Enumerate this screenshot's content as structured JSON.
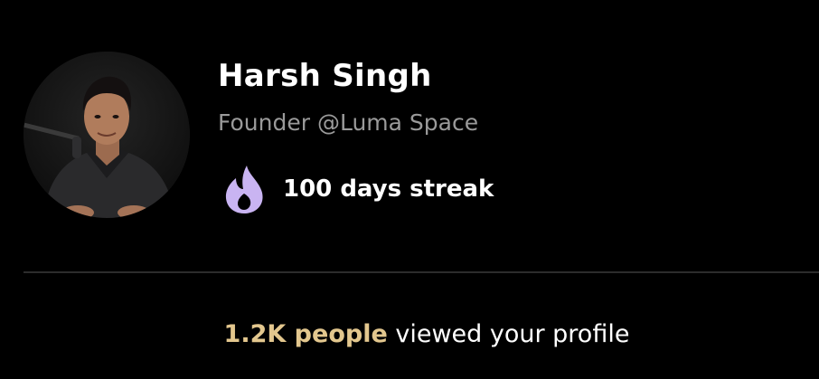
{
  "profile": {
    "name": "Harsh Singh",
    "role": "Founder @Luma Space",
    "streak_label": "100 days streak",
    "streak_icon": "flame-icon"
  },
  "views": {
    "highlight": "1.2K people",
    "suffix": " viewed your profile"
  },
  "colors": {
    "background": "#000000",
    "name": "#ffffff",
    "role": "#9a9a9a",
    "flame": "#c9b4f2",
    "highlight": "#e3c78e",
    "divider": "#2c2c2c"
  }
}
